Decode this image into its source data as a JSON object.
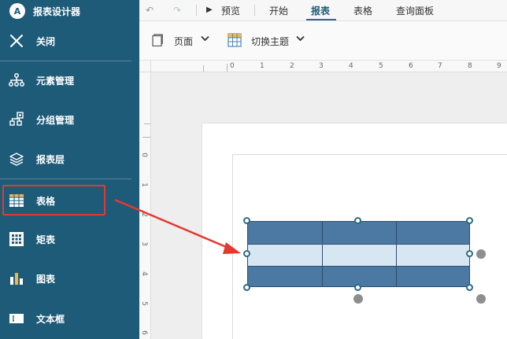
{
  "app": {
    "title": "报表设计器",
    "logo_glyph": "A"
  },
  "sidebar": {
    "items": [
      {
        "label": "关闭",
        "icon": "close-icon"
      },
      {
        "label": "元素管理",
        "icon": "hierarchy-icon"
      },
      {
        "label": "分组管理",
        "icon": "group-icon"
      },
      {
        "label": "报表层",
        "icon": "layers-icon"
      },
      {
        "label": "表格",
        "icon": "table-icon"
      },
      {
        "label": "矩表",
        "icon": "matrix-icon"
      },
      {
        "label": "图表",
        "icon": "bar-chart-icon"
      },
      {
        "label": "文本框",
        "icon": "textbox-icon"
      }
    ]
  },
  "toolbar": {
    "undo_glyph": "↶",
    "redo_glyph": "↷",
    "preview_glyph": "▶",
    "preview_label": "预览",
    "tabs": [
      "开始",
      "报表",
      "表格",
      "查询面板"
    ],
    "active_tab": "报表"
  },
  "ribbon": {
    "page_label": "页面",
    "switch_theme_label": "切换主题"
  },
  "ruler": {
    "top_labels": [
      "0",
      "1",
      "2",
      "3",
      "4",
      "5",
      "6",
      "7",
      "8",
      "9"
    ],
    "left_labels": [
      "0",
      "1",
      "2",
      "3",
      "4",
      "5",
      "6"
    ]
  },
  "colors": {
    "sidebar_bg": "#1e5b78",
    "highlight_red": "#e33a30",
    "table_dark": "#4b79a4",
    "table_light": "#d7e6f3"
  }
}
